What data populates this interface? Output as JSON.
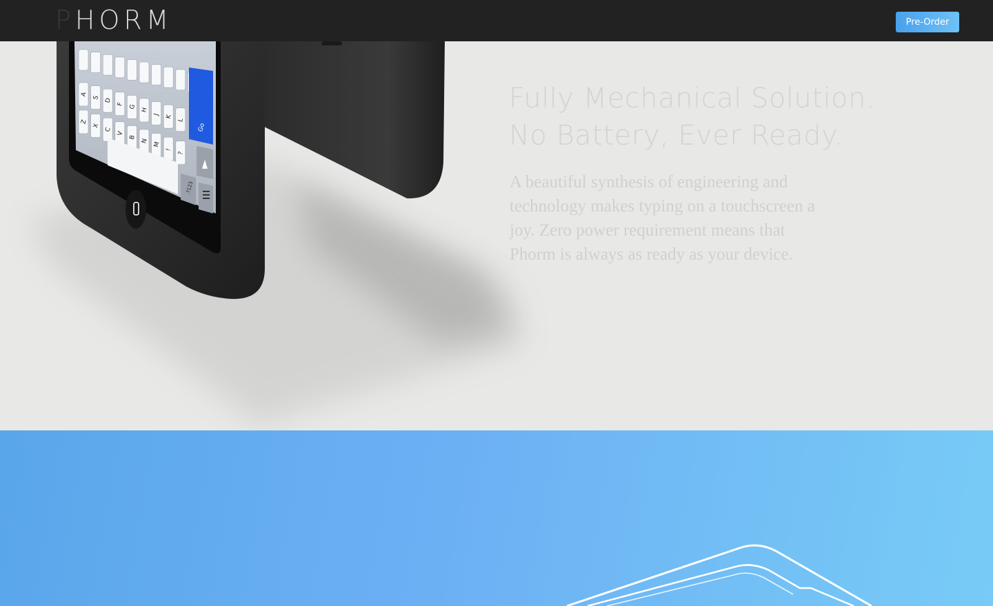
{
  "nav": {
    "logo_first": "P",
    "logo_rest": "HORM",
    "preorder_label": "Pre-Order"
  },
  "hero": {
    "headline": [
      "Fully Mechanical Solution.",
      "No Battery, Ever Ready."
    ],
    "body": "A beautiful synthesis of engineering and technology makes typing on a touchscreen a joy. Zero power requirement means that Phorm is always as ready as your device."
  },
  "keyboard": {
    "row1": [
      "A",
      "S",
      "D",
      "F",
      "G",
      "H",
      "J",
      "K",
      "L"
    ],
    "row2": [
      "Z",
      "X",
      "C",
      "V",
      "B",
      "N",
      "M",
      "!",
      "?"
    ],
    "go_label": "Go",
    "num_label": ".?123"
  },
  "colors": {
    "nav_bg": "#232223",
    "hero_bg": "#e8e9e6",
    "accent": "#4aa0ec",
    "blue_section_start": "#5aa6ea",
    "blue_section_end": "#78cbf6"
  }
}
